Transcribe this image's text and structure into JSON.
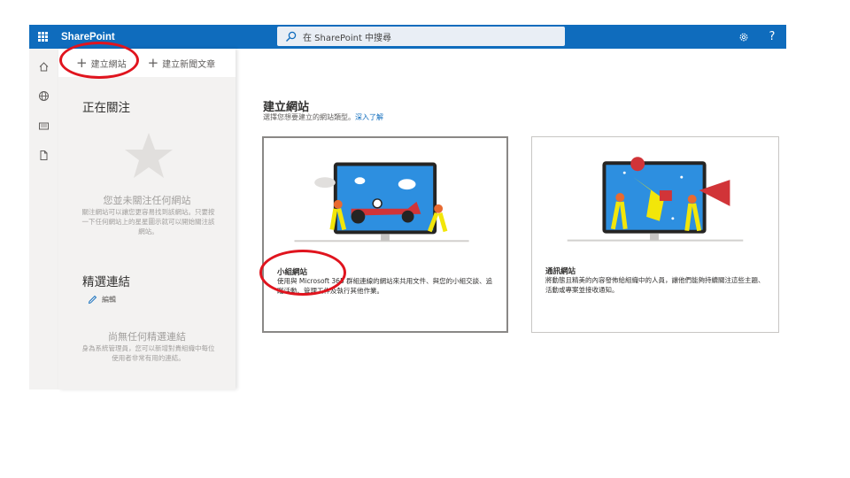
{
  "suite_bar": {
    "app_name": "SharePoint",
    "search_placeholder": "在 SharePoint 中搜尋",
    "accent": "#0f6cbd"
  },
  "command_bar": {
    "create_site_label": "建立網站",
    "create_news_label": "建立新聞文章"
  },
  "left_pane": {
    "following": {
      "title": "正在關注",
      "empty_title": "您並未關注任何網站",
      "empty_desc": "關注網站可以讓您更容易找到該網站。只要按一下任何網站上的星星圖示就可以開始關注該網站。"
    },
    "featured_links": {
      "title": "精選連結",
      "edit_label": "編輯",
      "empty_title": "尚無任何精選連結",
      "empty_desc": "身為系統管理員，您可以新增對貴組織中每位使用者非常有用的連結。"
    }
  },
  "main": {
    "title": "建立網站",
    "subtitle": "選擇您想要建立的網站類型。",
    "learn_more": "深入了解",
    "cards": [
      {
        "title": "小組網站",
        "description": "使用與 Microsoft 365 群組連線的網站來共用文件、與您的小組交談、追蹤活動、管理工作及執行其他作業。"
      },
      {
        "title": "通訊網站",
        "description": "將動態且精美的內容發佈給組織中的人員，讓他們能夠持續關注這些主題、活動或專案並接收通知。"
      }
    ]
  },
  "icons": [
    "app-launcher-icon",
    "search-icon",
    "gear-icon",
    "help-icon",
    "home-icon",
    "globe-icon",
    "news-icon",
    "file-icon",
    "plus-icon",
    "star-icon",
    "pencil-icon"
  ]
}
